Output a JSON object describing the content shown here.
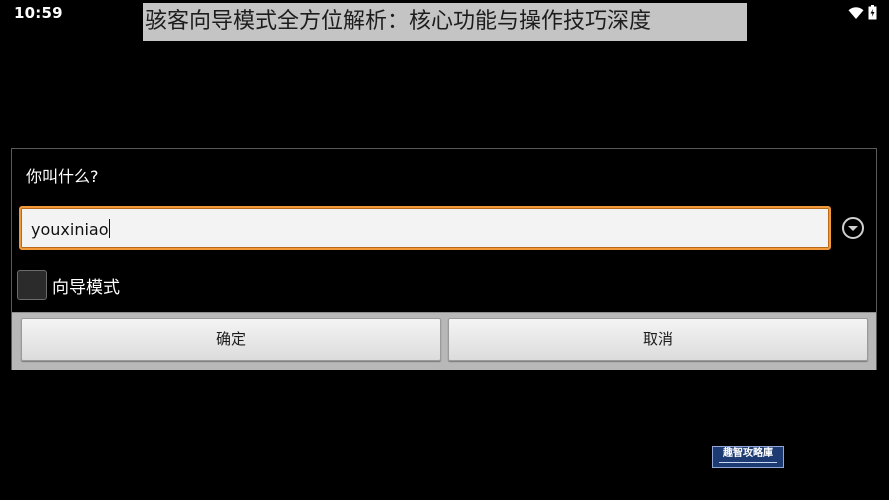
{
  "status_bar": {
    "time": "10:59",
    "icons": [
      "wifi-icon",
      "battery-icon"
    ]
  },
  "title_overlay": "骇客向导模式全方位解析：核心功能与操作技巧深度",
  "dialog": {
    "title": "你叫什么?",
    "input": {
      "value": "youxiniao"
    },
    "dropdown_icon": "chevron-down-circle-icon",
    "checkbox": {
      "label": "向导模式",
      "checked": false
    },
    "buttons": {
      "ok": "确定",
      "cancel": "取消"
    }
  },
  "watermark": {
    "text": "趣智攻略庫"
  },
  "colors": {
    "background": "#000000",
    "input_focus_border": "#f29a3a",
    "button_bar": "#b8b8b8",
    "watermark_bg": "#1d3a72"
  }
}
